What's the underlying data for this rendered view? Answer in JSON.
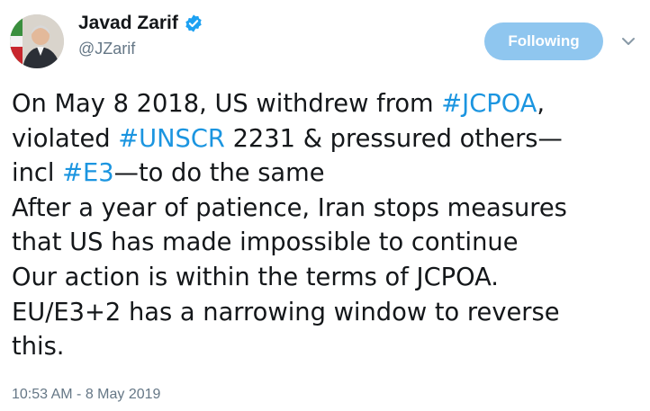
{
  "author": {
    "display_name": "Javad Zarif",
    "handle": "@JZarif",
    "verified": true,
    "avatar_icon": "profile-photo"
  },
  "follow_button": {
    "label": "Following",
    "color": "#8fc6ef"
  },
  "menu": {
    "icon": "chevron-down-icon"
  },
  "tweet": {
    "line1": {
      "a": "On May 8 2018, US withdrew from ",
      "h1": "#JCPOA",
      "b": ","
    },
    "line2": {
      "a": "violated ",
      "h1": "#UNSCR",
      "b": " 2231 & pressured others—"
    },
    "line3": {
      "a": "incl ",
      "h1": "#E3",
      "b": "—to do the same"
    },
    "line4": "After a year of patience, Iran stops measures",
    "line5": "that US has made impossible to continue",
    "line6": "Our action is within the terms of JCPOA.",
    "line7": "EU/E3+2 has a narrowing window to reverse",
    "line8": "this.",
    "hashtag_color": "#1b95e0"
  },
  "timestamp": "10:53 AM - 8 May 2019"
}
